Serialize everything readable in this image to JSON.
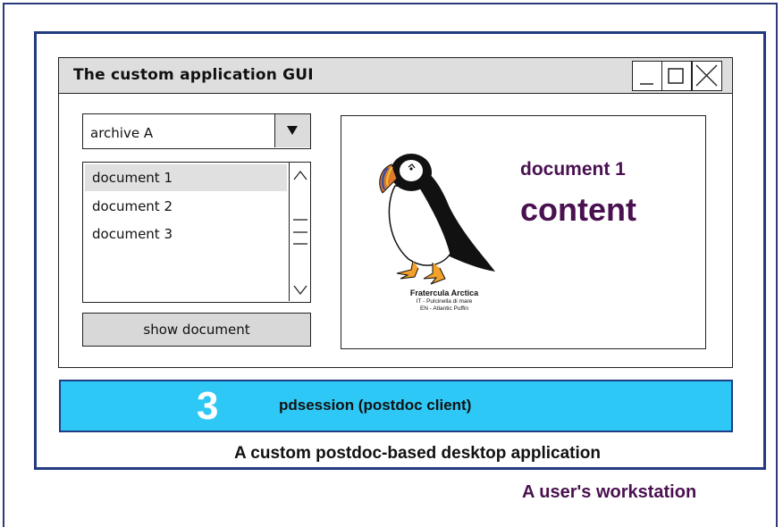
{
  "window": {
    "title": "The custom application GUI",
    "controls": [
      "minimize-icon",
      "maximize-icon",
      "close-icon"
    ]
  },
  "archive_select": {
    "selected": "archive A",
    "arrow_icon": "triangle-down-icon"
  },
  "document_list": {
    "items": [
      "document 1",
      "document 2",
      "document 3"
    ],
    "selected_index": 0
  },
  "show_button": {
    "label": "show document"
  },
  "content": {
    "title": "document 1",
    "body": "content",
    "image_icon": "puffin-icon",
    "caption": {
      "name": "Fratercula Arctica",
      "it": "IT - Pulcinella di mare",
      "en": "EN - Atlantic Puffin"
    }
  },
  "pdsession": {
    "number": "3",
    "label": "pdsession (postdoc client)",
    "color": "#2ec8f6"
  },
  "captions": {
    "application": "A custom postdoc-based desktop application",
    "workstation": "A user's workstation"
  },
  "colors": {
    "frame": "#223a80",
    "heading": "#4a1150"
  }
}
